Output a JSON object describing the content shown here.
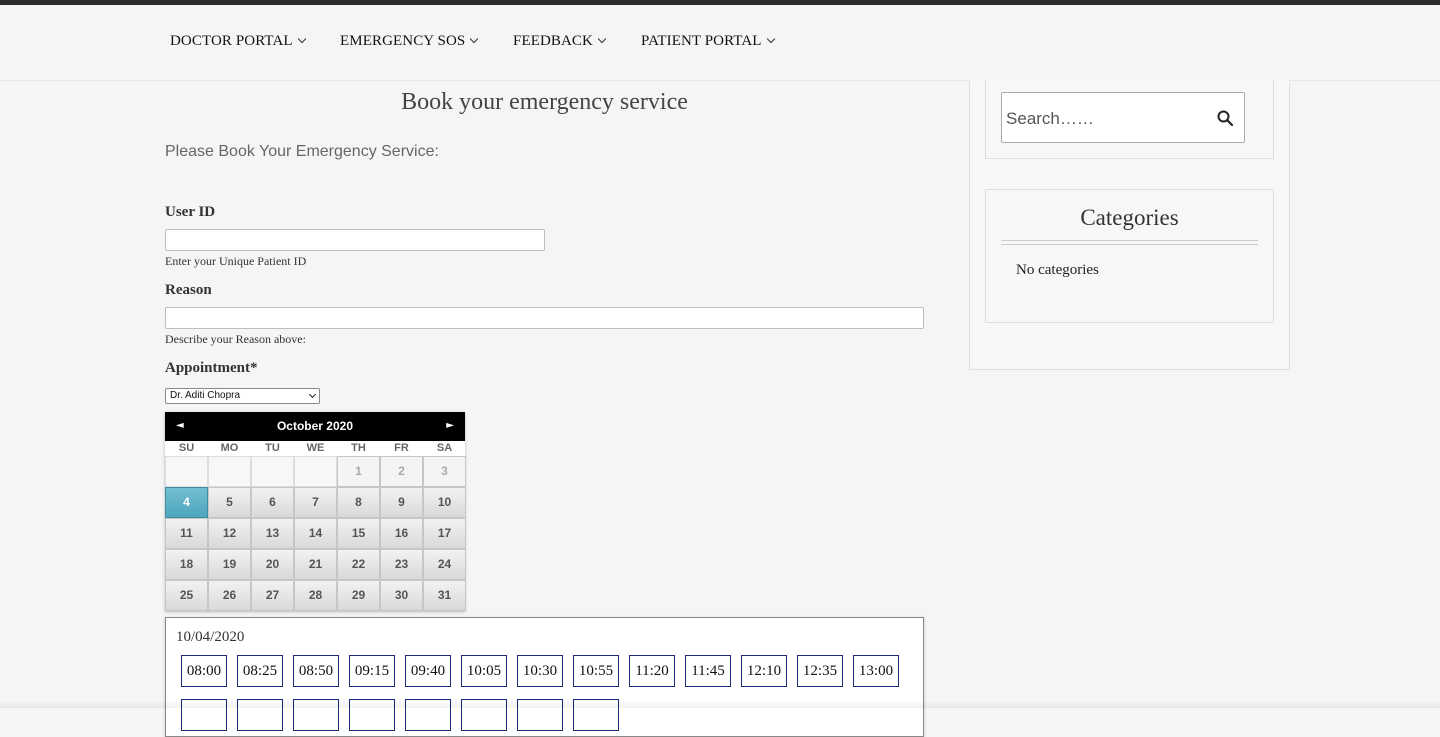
{
  "nav": {
    "items": [
      {
        "label": "DOCTOR PORTAL"
      },
      {
        "label": "EMERGENCY SOS"
      },
      {
        "label": "FEEDBACK"
      },
      {
        "label": "PATIENT PORTAL"
      }
    ]
  },
  "page": {
    "title": "Book your emergency service",
    "intro": "Please Book Your Emergency Service:"
  },
  "form": {
    "user_id": {
      "label": "User ID",
      "help": "Enter your Unique Patient ID",
      "value": ""
    },
    "reason": {
      "label": "Reason",
      "help": "Describe your Reason above:",
      "value": ""
    },
    "appointment": {
      "label": "Appointment*",
      "selected": "Dr. Aditi Chopra"
    }
  },
  "calendar": {
    "month_label": "October 2020",
    "prev_glyph": "◄",
    "next_glyph": "►",
    "weekdays": [
      "SU",
      "MO",
      "TU",
      "WE",
      "TH",
      "FR",
      "SA"
    ],
    "weeks": [
      [
        "",
        "",
        "",
        "",
        "1",
        "2",
        "3"
      ],
      [
        "4",
        "5",
        "6",
        "7",
        "8",
        "9",
        "10"
      ],
      [
        "11",
        "12",
        "13",
        "14",
        "15",
        "16",
        "17"
      ],
      [
        "18",
        "19",
        "20",
        "21",
        "22",
        "23",
        "24"
      ],
      [
        "25",
        "26",
        "27",
        "28",
        "29",
        "30",
        "31"
      ]
    ],
    "selected_day": "4",
    "muted_days": [
      "1",
      "2",
      "3"
    ]
  },
  "timeslots": {
    "date": "10/04/2020",
    "slots": [
      "08:00",
      "08:25",
      "08:50",
      "09:15",
      "09:40",
      "10:05",
      "10:30",
      "10:55",
      "11:20",
      "11:45",
      "12:10",
      "12:35",
      "13:00"
    ]
  },
  "sidebar": {
    "search_placeholder": "Search……",
    "categories_title": "Categories",
    "categories_empty": "No categories"
  }
}
